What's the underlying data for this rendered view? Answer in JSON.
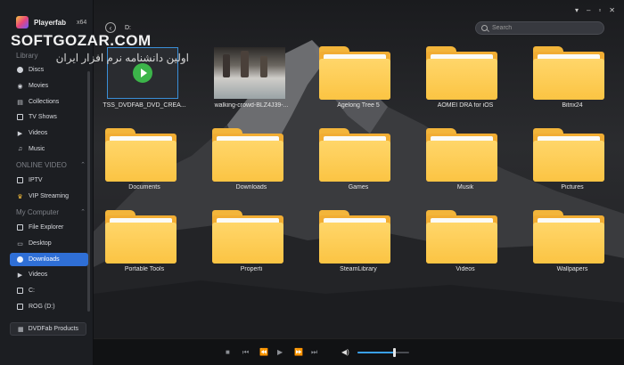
{
  "app": {
    "name": "Playerfab",
    "arch": "x64",
    "watermark_title": "SOFTGOZAR.COM",
    "watermark_sub": "اولین دانشنامه نرم افزار ایران"
  },
  "window_controls": [
    "▾",
    "–",
    "▫",
    "✕"
  ],
  "sidebar": {
    "library_label": "Library",
    "library_items": [
      {
        "label": "Discs",
        "icon": "disc-icon"
      },
      {
        "label": "Movies",
        "icon": "movies-icon"
      },
      {
        "label": "Collections",
        "icon": "collections-icon"
      },
      {
        "label": "TV Shows",
        "icon": "tv-icon"
      },
      {
        "label": "Videos",
        "icon": "videos-icon"
      },
      {
        "label": "Music",
        "icon": "music-icon"
      }
    ],
    "online_label": "ONLINE VIDEO",
    "online_items": [
      {
        "label": "IPTV",
        "icon": "iptv-icon"
      },
      {
        "label": "VIP Streaming",
        "icon": "crown-icon"
      }
    ],
    "computer_label": "My Computer",
    "computer_items": [
      {
        "label": "File Explorer",
        "icon": "file-explorer-icon"
      },
      {
        "label": "Desktop",
        "icon": "desktop-icon"
      },
      {
        "label": "Downloads",
        "icon": "downloads-icon",
        "active": true
      },
      {
        "label": "Videos",
        "icon": "videos-icon"
      },
      {
        "label": "C:",
        "icon": "drive-icon"
      },
      {
        "label": "ROG (D:)",
        "icon": "drive-icon"
      }
    ],
    "products_label": "DVDFab Products"
  },
  "topbar": {
    "path": "D:",
    "search_placeholder": "Search"
  },
  "items": [
    {
      "kind": "dvd",
      "label": "TSS_DVDFAB_DVD_CREA..."
    },
    {
      "kind": "video",
      "label": "walking-crowd-BLZ4J39-..."
    },
    {
      "kind": "folder",
      "label": "Agelong Tree 5"
    },
    {
      "kind": "folder",
      "label": "AOMEI DRA for iOS"
    },
    {
      "kind": "folder",
      "label": "Bitrix24"
    },
    {
      "kind": "folder",
      "label": "Documents"
    },
    {
      "kind": "folder",
      "label": "Downloads"
    },
    {
      "kind": "folder",
      "label": "Games"
    },
    {
      "kind": "folder",
      "label": "Musik"
    },
    {
      "kind": "folder",
      "label": "Pictures"
    },
    {
      "kind": "folder",
      "label": "Portable Tools"
    },
    {
      "kind": "folder",
      "label": "Properti"
    },
    {
      "kind": "folder",
      "label": "SteamLibrary"
    },
    {
      "kind": "folder",
      "label": "Videos"
    },
    {
      "kind": "folder",
      "label": "Wallpapers"
    }
  ],
  "player": {
    "volume": 0.7
  },
  "colors": {
    "accent": "#2f6fd6",
    "folder": "#fbc443",
    "play": "#3cb54a"
  }
}
